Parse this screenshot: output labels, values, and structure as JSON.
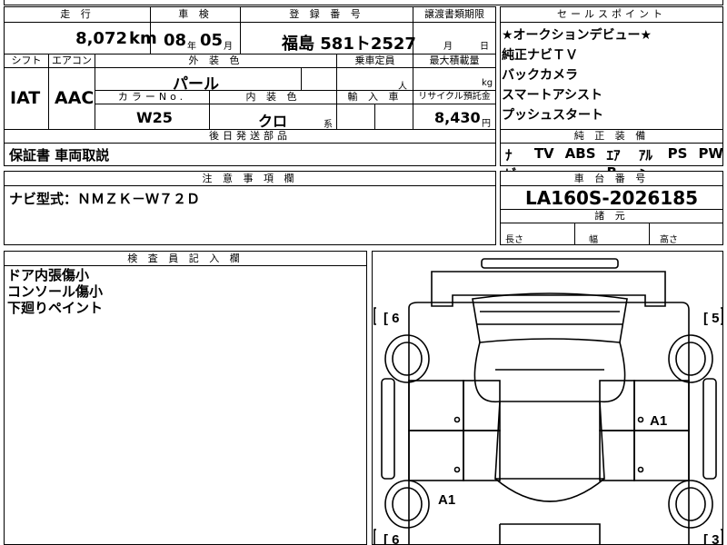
{
  "labels": {
    "mileage": "走 行",
    "inspection": "車 検",
    "registration": "登 録 番 号",
    "transfer": "譲渡書類期限",
    "sales_points": "セールスポイント",
    "shift": "シフト",
    "aircon": "エアコン",
    "exterior_color": "外 装 色",
    "capacity": "乗車定員",
    "max_load": "最大積載量",
    "color_no": "カラーNo.",
    "interior_color": "内 装 色",
    "import": "輸 入 車",
    "recycle": "リサイクル預託金",
    "later_parts": "後日発送部品",
    "notes": "注 意 事 項 欄",
    "inspector": "検 査 員 記 入 欄",
    "equipment": "純 正 装 備",
    "chassis": "車 台 番 号",
    "dimensions": "諸 元",
    "length": "長さ",
    "width": "幅",
    "height": "高さ"
  },
  "vehicle": {
    "mileage": "8,072",
    "mileage_unit": "km",
    "inspection_year": "08",
    "year_unit": "年",
    "inspection_month": "05",
    "month_unit": "月",
    "plate": "福島 581ト2527",
    "transfer_month": "月",
    "transfer_day": "日",
    "shift": "IAT",
    "aircon": "AAC",
    "exterior_color": "パール",
    "capacity_unit": "人",
    "load_unit": "kg",
    "color_no": "W25",
    "interior_color": "クロ",
    "interior_suffix": "系",
    "recycle_fee": "8,430",
    "recycle_unit": "円",
    "later_parts": "保証書 車両取説",
    "notes": "ナビ型式：ＮＭＺＫ－Ｗ７２Ｄ",
    "chassis_no": "LA160S-2026185"
  },
  "sales_points": [
    "★オークションデビュー★",
    "純正ナビＴＶ",
    "バックカメラ",
    "スマートアシスト",
    "プッシュスタート"
  ],
  "equipment": [
    "ﾅﾋﾞ",
    "TV",
    "ABS",
    "ｴｱB",
    "ｱﾙﾐ",
    "PS",
    "PW"
  ],
  "inspector_notes": [
    "ドア内張傷小",
    "コンソール傷小",
    "下廻りペイント"
  ],
  "diagram": {
    "corner_tl": "6",
    "corner_tr": "5",
    "corner_bl": "6",
    "corner_br": "3",
    "mark_right": "A1",
    "mark_left": "A1"
  }
}
